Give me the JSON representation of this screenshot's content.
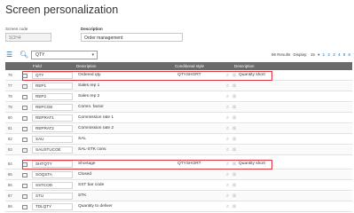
{
  "page": {
    "title": "Screen personalization"
  },
  "form": {
    "screen_code": {
      "label": "Screen code",
      "value": "SOH4"
    },
    "description": {
      "label": "Description",
      "value": "Order management"
    }
  },
  "toolbar": {
    "search_value": "QTY",
    "results_text": "96 Results",
    "display_label": "Display:",
    "display_value": "15",
    "pages": [
      "1",
      "2",
      "3",
      "4",
      "5",
      "6",
      "7"
    ]
  },
  "grid": {
    "columns": {
      "field": "Field",
      "description": "Description",
      "conditional_style": "Conditional style",
      "description2": "Description"
    },
    "rows": [
      {
        "num": "76",
        "field": "QTY",
        "description": "Ordered qty.",
        "cond_style": "QTYSHORT",
        "description2": "Quantity short",
        "highlighted": true
      },
      {
        "num": "77",
        "field": "REP1",
        "description": "Sales rep 1",
        "cond_style": "",
        "description2": ""
      },
      {
        "num": "78",
        "field": "REP2",
        "description": "Sales rep 2",
        "cond_style": "",
        "description2": ""
      },
      {
        "num": "79",
        "field": "REPCOE",
        "description": "Comm. factor",
        "cond_style": "",
        "description2": ""
      },
      {
        "num": "80",
        "field": "REPRAT1",
        "description": "Commission rate 1",
        "cond_style": "",
        "description2": ""
      },
      {
        "num": "81",
        "field": "REPRAT2",
        "description": "Commission rate 2",
        "cond_style": "",
        "description2": ""
      },
      {
        "num": "82",
        "field": "SAU",
        "description": "SAL",
        "cond_style": "",
        "description2": ""
      },
      {
        "num": "83",
        "field": "SAUSTUCOE",
        "description": "SAL-STK conv.",
        "cond_style": "",
        "description2": ""
      },
      {
        "num": "84",
        "field": "SHTQTY",
        "description": "Shortage",
        "cond_style": "QTYSHORT",
        "description2": "Quantity short",
        "highlighted": true
      },
      {
        "num": "85",
        "field": "SOQSTA",
        "description": "Closed",
        "cond_style": "",
        "description2": ""
      },
      {
        "num": "86",
        "field": "SSTCOD",
        "description": "SST bar code",
        "cond_style": "",
        "description2": ""
      },
      {
        "num": "87",
        "field": "STU",
        "description": "STK",
        "cond_style": "",
        "description2": ""
      },
      {
        "num": "88",
        "field": "TDLQTY",
        "description": "Quantity to deliver",
        "cond_style": "",
        "description2": ""
      }
    ]
  }
}
